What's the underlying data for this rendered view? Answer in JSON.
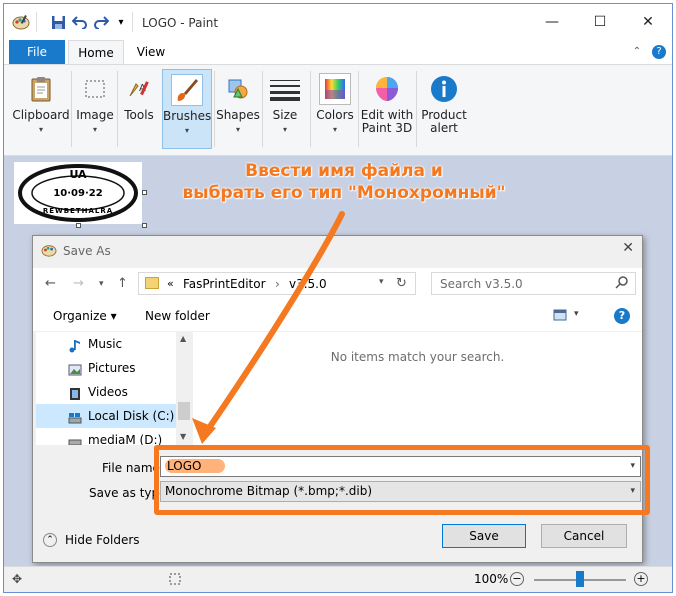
{
  "window": {
    "title": "LOGO - Paint",
    "minimize_glyph": "—",
    "maximize_glyph": "☐",
    "close_glyph": "✕"
  },
  "menu": {
    "tabs": [
      {
        "label": "File"
      },
      {
        "label": "Home"
      },
      {
        "label": "View"
      }
    ],
    "help_glyph": "?",
    "collapse_glyph": "⌃"
  },
  "ribbon": {
    "groups": [
      {
        "label": "Clipboard",
        "icon": "clipboard-icon"
      },
      {
        "label": "Image",
        "icon": "select-icon"
      },
      {
        "label": "Tools",
        "icon": "tools-icon"
      },
      {
        "label": "Brushes",
        "icon": "brush-icon"
      },
      {
        "label": "Shapes",
        "icon": "shapes-icon"
      },
      {
        "label": "Size",
        "icon": "size-icon"
      },
      {
        "label": "Colors",
        "icon": "colors-icon"
      },
      {
        "label": "Edit with",
        "label2": "Paint 3D",
        "icon": "paint3d-icon"
      },
      {
        "label": "Product",
        "label2": "alert",
        "icon": "info-icon"
      }
    ],
    "caret": "▾"
  },
  "canvas": {
    "stamp_top": "UA",
    "stamp_date": "10·09·22",
    "stamp_ring_text": "REWBETHALRA"
  },
  "annotation": {
    "line1": "Ввести имя файла и",
    "line2": "выбрать его тип \"Монохромный\"",
    "color": "#f5781f"
  },
  "dialog": {
    "title": "Save As",
    "close_glyph": "✕",
    "breadcrumb": {
      "prefix": "«",
      "folder": "FasPrintEditor",
      "separator": "›",
      "subfolder": "v3.5.0"
    },
    "search_placeholder": "Search v3.5.0",
    "toolbar": {
      "organize": "Organize ▾",
      "new_folder": "New folder"
    },
    "nav_items": [
      {
        "label": "Music",
        "icon": "music-icon"
      },
      {
        "label": "Pictures",
        "icon": "pictures-icon"
      },
      {
        "label": "Videos",
        "icon": "videos-icon"
      },
      {
        "label": "Local Disk (C:)",
        "icon": "disk-icon",
        "selected": true
      },
      {
        "label": "mediaM (D:)",
        "icon": "drive-icon"
      }
    ],
    "empty_message": "No items match your search.",
    "file_name_label": "File name:",
    "file_name_value": "LOGO",
    "save_type_label": "Save as type:",
    "save_type_value": "Monochrome Bitmap (*.bmp;*.dib)",
    "hide_folders": "Hide Folders",
    "save_button": "Save",
    "cancel_button": "Cancel"
  },
  "status": {
    "zoom": "100%",
    "zoom_level": 100
  },
  "colors": {
    "accent": "#1979ca",
    "highlight": "#f47920",
    "canvas_bg": "#c8d1e3"
  }
}
